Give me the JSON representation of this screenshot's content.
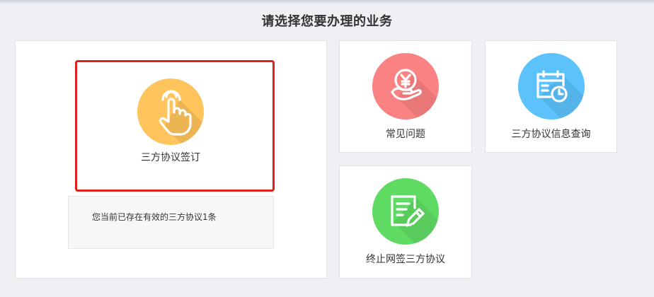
{
  "page": {
    "title": "请选择您要办理的业务"
  },
  "services": {
    "sign": {
      "label": "三方协议签订",
      "icon": "hand-tap-icon",
      "color": "#ffc55c",
      "selected": true
    },
    "faq": {
      "label": "常见问题",
      "icon": "yen-coin-hand-icon",
      "color": "#fa8282"
    },
    "query": {
      "label": "三方协议信息查询",
      "icon": "calendar-clock-icon",
      "color": "#5bc2fb"
    },
    "terminate": {
      "label": "终止网签三方协议",
      "icon": "document-edit-icon",
      "color": "#5fdb63"
    }
  },
  "notice": {
    "text": "您当前已存在有效的三方协议1条"
  },
  "colors": {
    "highlight": "#e0201c",
    "background": "#eef0f4"
  }
}
